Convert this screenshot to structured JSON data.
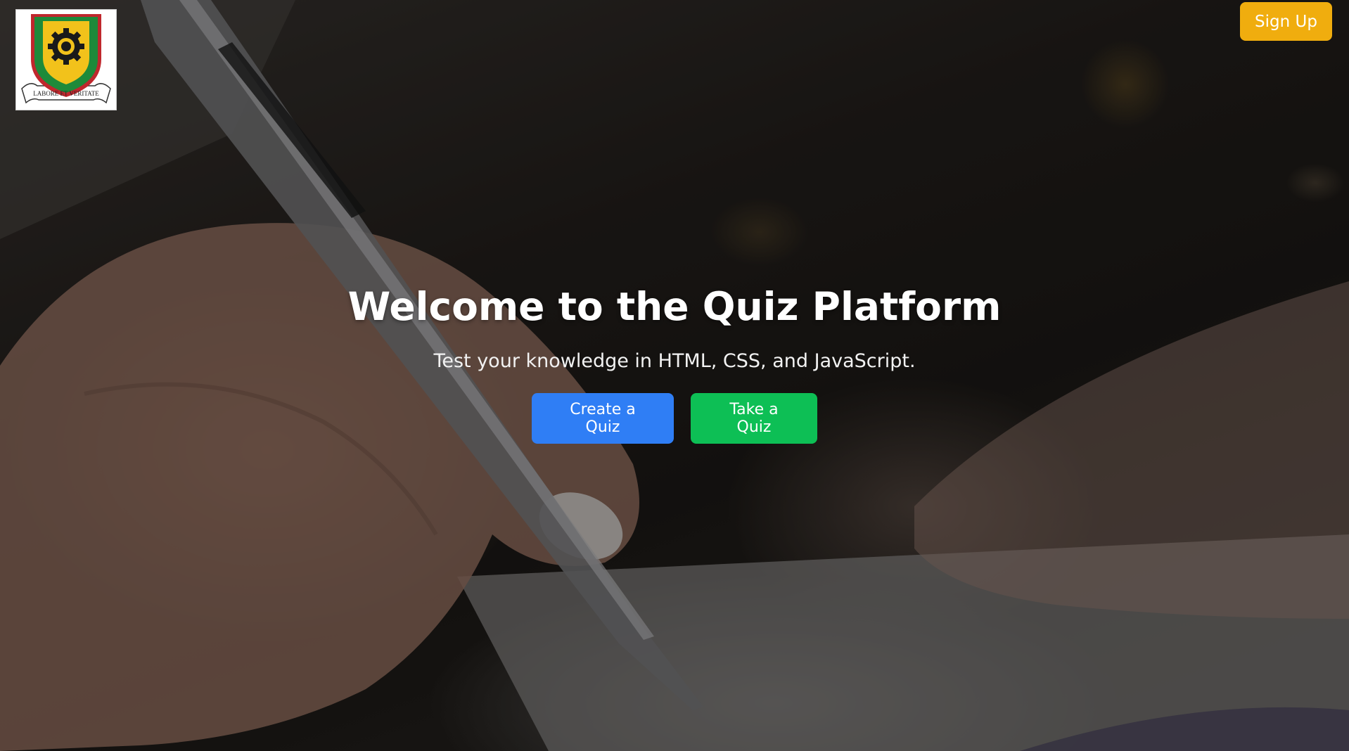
{
  "header": {
    "logo": {
      "motto": "LABORE ET VERITATE",
      "colors": {
        "shield_green": "#1e8a3a",
        "shield_gold": "#f2c21b",
        "gear": "#1a1a1a",
        "border_red": "#c0272d"
      }
    },
    "signup_label": "Sign Up"
  },
  "hero": {
    "title": "Welcome to the Quiz Platform",
    "subtitle": "Test your knowledge in HTML, CSS, and JavaScript.",
    "create_label": "Create a Quiz",
    "take_label": "Take a Quiz"
  },
  "colors": {
    "signup": "#f0ad0e",
    "create": "#2f7ef5",
    "take": "#0dbf55"
  }
}
